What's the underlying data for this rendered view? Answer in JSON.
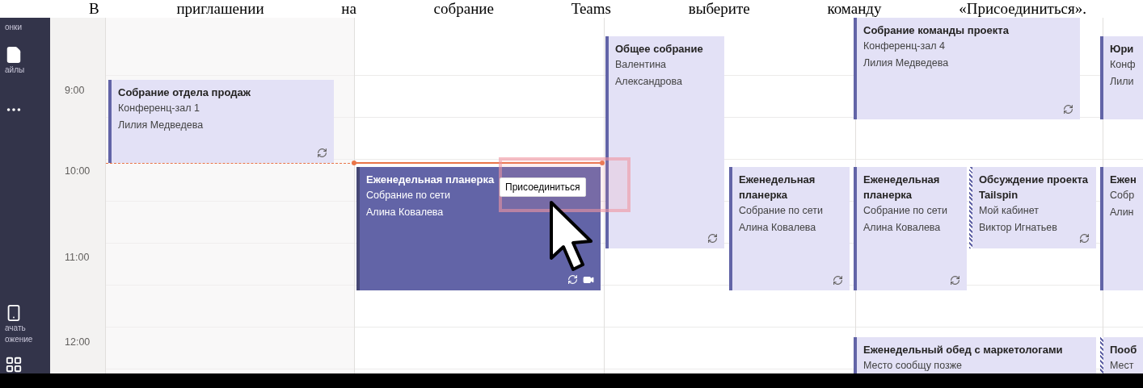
{
  "caption": "В приглашении на собрание Teams выберите команду «Присоединиться».",
  "sidebar": [
    {
      "kind": "calls",
      "lines": [
        "онки"
      ]
    },
    {
      "kind": "files",
      "lines": [
        "айлы"
      ]
    },
    {
      "kind": "more"
    },
    {
      "kind": "device",
      "lines": [
        "ачать",
        "ожение"
      ]
    },
    {
      "kind": "apps"
    }
  ],
  "time_labels": [
    "9:00",
    "10:00",
    "11:00",
    "12:00"
  ],
  "events": [
    {
      "title": "Собрание отдела продаж",
      "lines": [
        "Конференц-зал 1",
        "Лилия Медведева"
      ],
      "selected": false,
      "tentative": false,
      "recurring": true,
      "online": false
    },
    {
      "title": "Еженедельная планерка",
      "lines": [
        "Собрание по сети",
        "Алина Ковалева"
      ],
      "selected": true,
      "tentative": false,
      "recurring": true,
      "online": true
    },
    {
      "title": "Общее собрание",
      "lines": [
        "Валентина",
        "Александрова"
      ],
      "selected": false,
      "tentative": false,
      "recurring": true,
      "online": false
    },
    {
      "title": "Еженедельная планерка",
      "lines": [
        "Собрание по сети",
        "Алина Ковалева"
      ],
      "selected": false,
      "tentative": false,
      "recurring": true,
      "online": false
    },
    {
      "title": "Собрание команды проекта",
      "lines": [
        "Конференц-зал 4",
        "Лилия Медведева"
      ],
      "selected": false,
      "tentative": false,
      "recurring": true,
      "online": false
    },
    {
      "title": "Еженедельная планерка",
      "lines": [
        "Собрание по сети",
        "Алина Ковалева"
      ],
      "selected": false,
      "tentative": false,
      "recurring": true,
      "online": false
    },
    {
      "title": "Обсуждение проекта Tailspin",
      "lines": [
        "Мой кабинет",
        "Виктор Игнатьев"
      ],
      "selected": false,
      "tentative": true,
      "recurring": true,
      "online": false
    },
    {
      "title": "Еженедельный обед с маркетологами",
      "lines": [
        "Место сообщу позже"
      ],
      "selected": false,
      "tentative": false,
      "recurring": false,
      "online": false
    },
    {
      "title": "Юри",
      "lines": [
        "Конф",
        "Лили"
      ],
      "selected": false,
      "tentative": false,
      "recurring": false,
      "online": false
    },
    {
      "title": "Ежен",
      "lines": [
        "Собр",
        "Алин"
      ],
      "selected": false,
      "tentative": false,
      "recurring": false,
      "online": false
    },
    {
      "title": "Пооб",
      "lines": [
        "Мест"
      ],
      "selected": false,
      "tentative": true,
      "recurring": false,
      "online": false
    }
  ],
  "join_button": "Присоединиться"
}
